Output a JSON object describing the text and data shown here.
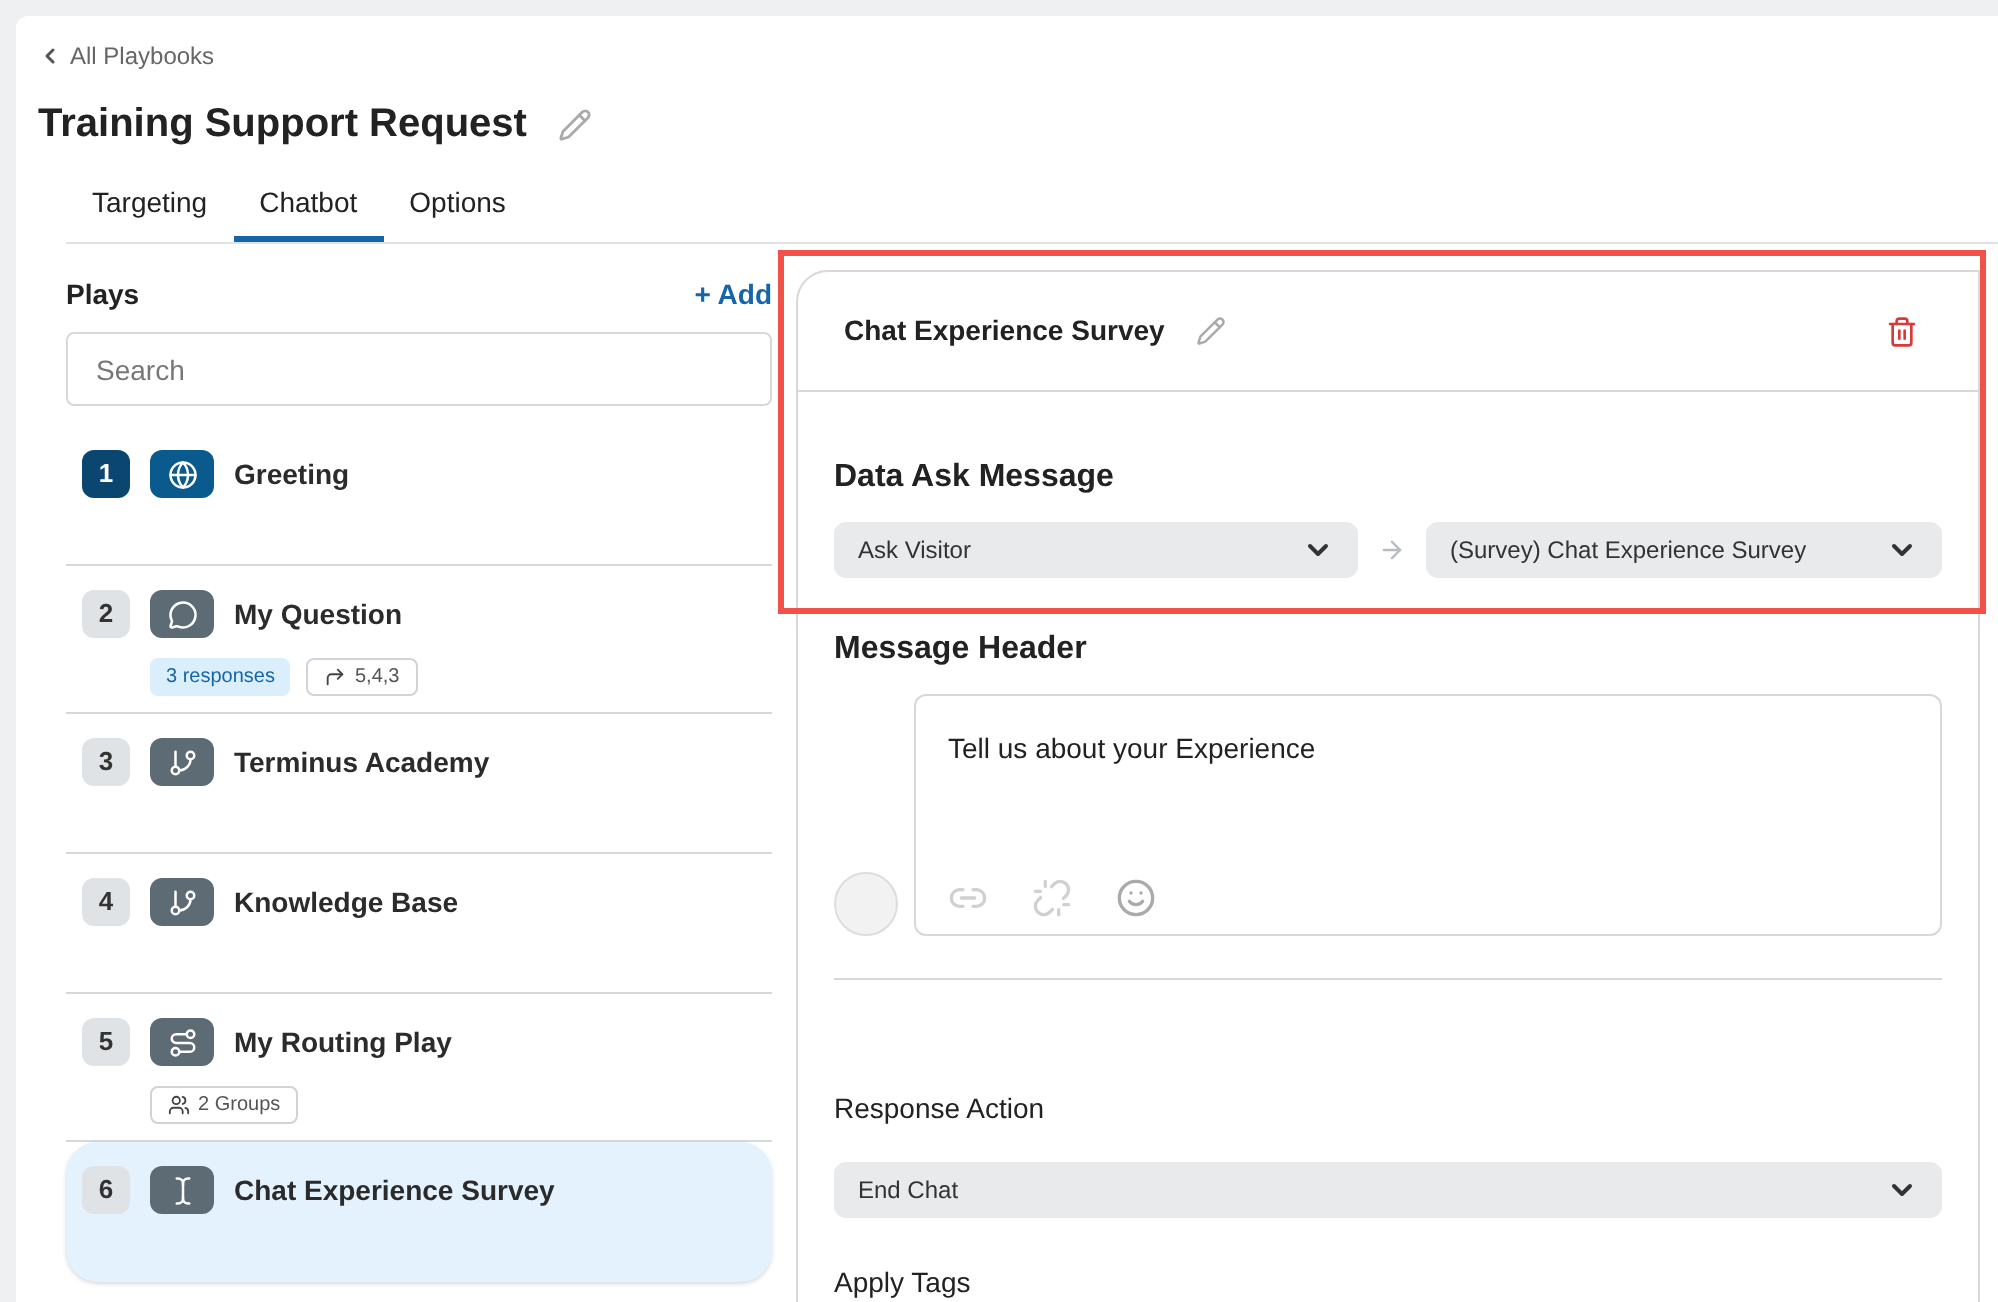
{
  "breadcrumb": {
    "label": "All Playbooks"
  },
  "title": "Training Support Request",
  "tabs": [
    {
      "label": "Targeting",
      "selected": false
    },
    {
      "label": "Chatbot",
      "selected": true
    },
    {
      "label": "Options",
      "selected": false
    }
  ],
  "plays": {
    "heading": "Plays",
    "add_label": "+ Add",
    "search": {
      "placeholder": "Search"
    },
    "items": [
      {
        "number": "1",
        "kind": "greeting",
        "name": "Greeting",
        "selected": false
      },
      {
        "number": "2",
        "kind": "question",
        "name": "My Question",
        "selected": false,
        "tags": [
          {
            "kind": "responses",
            "text": "3 responses"
          },
          {
            "kind": "routes",
            "text": "5,4,3"
          }
        ]
      },
      {
        "number": "3",
        "kind": "branch",
        "name": "Terminus Academy",
        "selected": false
      },
      {
        "number": "4",
        "kind": "branch",
        "name": "Knowledge Base",
        "selected": false
      },
      {
        "number": "5",
        "kind": "routing",
        "name": "My Routing Play",
        "selected": false,
        "tags": [
          {
            "kind": "groups",
            "text": "2 Groups"
          }
        ]
      },
      {
        "number": "6",
        "kind": "survey",
        "name": "Chat Experience Survey",
        "selected": true
      }
    ]
  },
  "detail": {
    "title": "Chat Experience Survey",
    "highlighted": true,
    "data_ask": {
      "heading": "Data Ask Message",
      "source": "Ask Visitor",
      "target": "(Survey) Chat Experience Survey"
    },
    "message_header": {
      "heading": "Message Header",
      "value": "Tell us about your Experience"
    },
    "response_action": {
      "label": "Response Action",
      "value": "End Chat"
    },
    "apply_tags": {
      "label": "Apply Tags"
    }
  }
}
